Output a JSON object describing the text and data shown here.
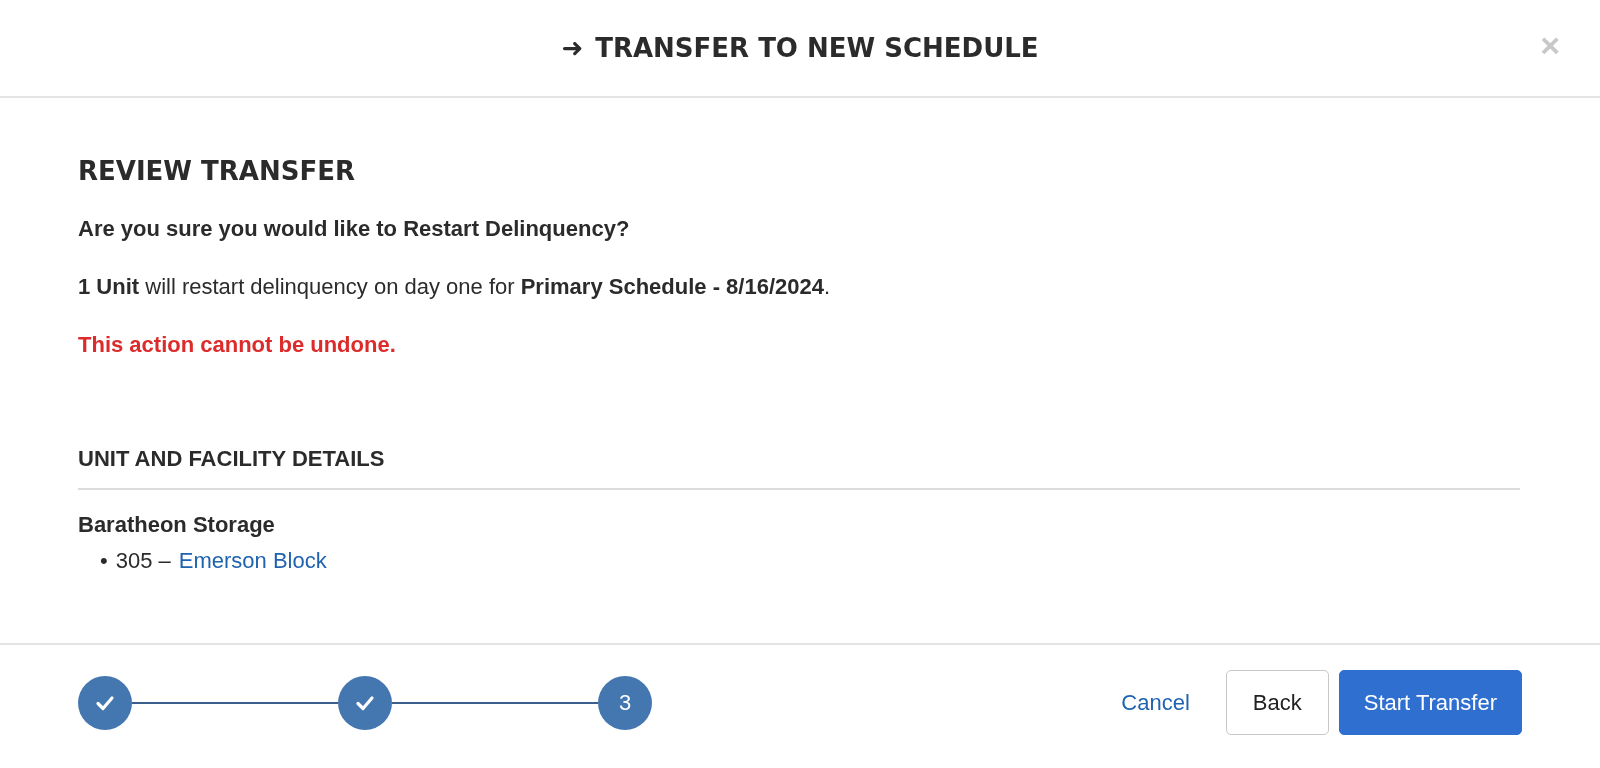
{
  "dialog": {
    "title_icon": "➜",
    "title": "TRANSFER TO NEW SCHEDULE",
    "close": "×"
  },
  "review": {
    "heading": "REVIEW TRANSFER",
    "question": "Are you sure you would like to Restart Delinquency?",
    "summary": "**1 Unit** will restart delinquency on day one for **Primary Schedule - 8/16/2024**.",
    "warning": "This action cannot be undone."
  },
  "details": {
    "heading": "UNIT AND FACILITY DETAILS",
    "facility": "Baratheon Storage",
    "units": [
      {
        "bullet": "•",
        "number": "305 –",
        "name": "Emerson Block"
      }
    ]
  },
  "steps": [
    {
      "done": true
    },
    {
      "done": true
    },
    {
      "done": false,
      "label": "3"
    }
  ],
  "buttons": {
    "cancel": "Cancel",
    "back": "Back",
    "primary": "Start Transfer"
  }
}
